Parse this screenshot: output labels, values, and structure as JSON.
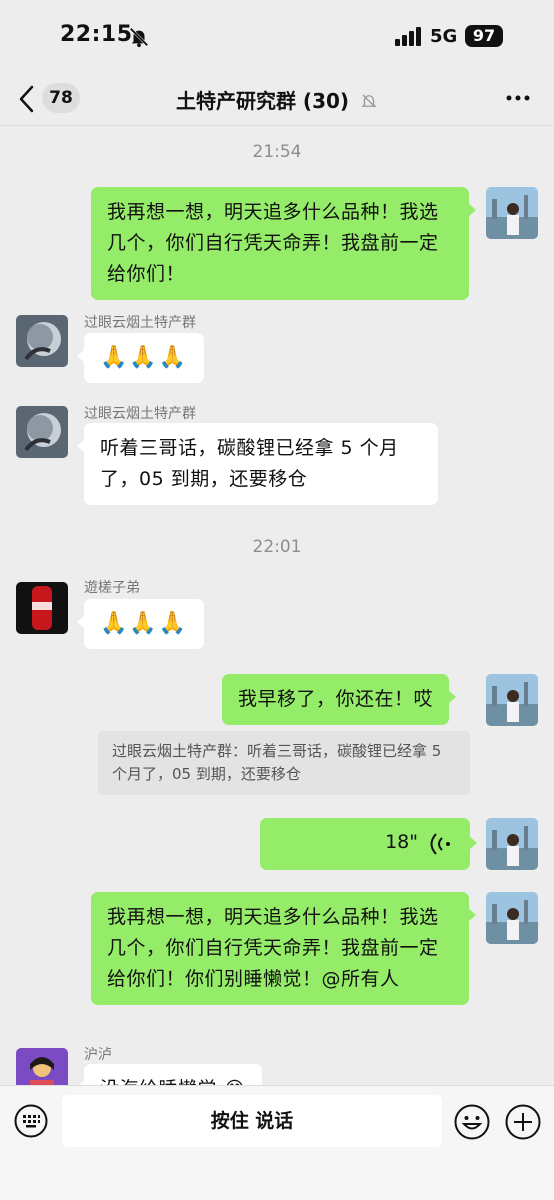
{
  "status": {
    "time": "22:15",
    "network": "5G",
    "battery": "97"
  },
  "nav": {
    "unread": "78",
    "title": "土特产研究群 (30)"
  },
  "messages": {
    "ts1": "21:54",
    "m1": "我再想一想，明天追多什么品种！我选几个，你们自行凭天命弄！我盘前一定给你们！",
    "m2_sender": "过眼云烟土特产群",
    "m2_text": "🙏🙏🙏",
    "m3_sender": "过眼云烟土特产群",
    "m3_text": "听着三哥话，碳酸锂已经拿 5 个月了，05 到期，还要移仓",
    "ts2": "22:01",
    "m4_sender": "遊槎子弟",
    "m4_text": "🙏🙏🙏",
    "m5": "我早移了，你还在！哎",
    "m5_quote": "过眼云烟土特产群：听着三哥话，碳酸锂已经拿 5 个月了，05 到期，还要移仓",
    "m6_voice": "18\"",
    "m7": "我再想一想，明天追多什么品种！我选几个，你们自行凭天命弄！我盘前一定给你们！你们别睡懒觉！@所有人",
    "m8_sender": "沪泸",
    "m8_text": "没海给睡懒觉 😂"
  },
  "input": {
    "hold_to_talk": "按住 说话"
  },
  "colors": {
    "my_bubble": "#95ec69",
    "their_bubble": "#ffffff",
    "background": "#ededed"
  }
}
